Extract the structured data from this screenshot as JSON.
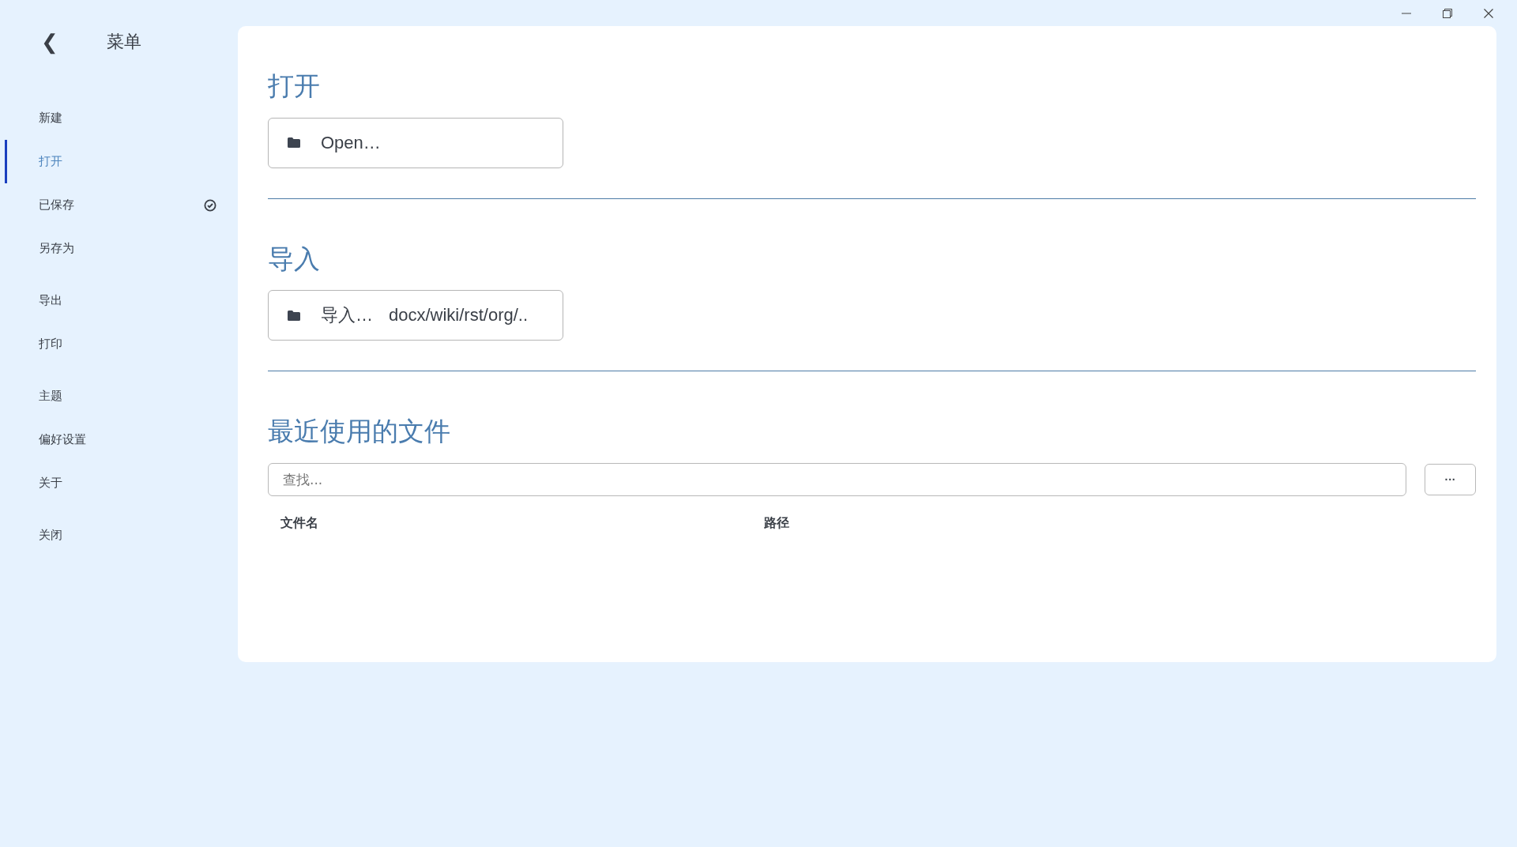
{
  "sidebar": {
    "back": "❮",
    "title": "菜单",
    "groups": [
      [
        {
          "label": "新建",
          "selected": false,
          "kind": "plain"
        },
        {
          "label": "打开",
          "selected": true,
          "kind": "plain"
        },
        {
          "label": "已保存",
          "selected": false,
          "kind": "check"
        },
        {
          "label": "另存为",
          "selected": false,
          "kind": "plain"
        }
      ],
      [
        {
          "label": "导出",
          "selected": false,
          "kind": "plain"
        },
        {
          "label": "打印",
          "selected": false,
          "kind": "plain"
        }
      ],
      [
        {
          "label": "主题",
          "selected": false,
          "kind": "plain"
        },
        {
          "label": "偏好设置",
          "selected": false,
          "kind": "plain"
        },
        {
          "label": "关于",
          "selected": false,
          "kind": "plain"
        }
      ],
      [
        {
          "label": "关闭",
          "selected": false,
          "kind": "plain"
        }
      ]
    ]
  },
  "sections": [
    {
      "heading": "打开",
      "button": {
        "label": "Open…"
      }
    },
    {
      "heading": "导入",
      "button": {
        "label": "导入…",
        "hint": "docx/wiki/rst/org/.."
      }
    }
  ],
  "recent": {
    "heading": "最近使用的文件",
    "search": {
      "placeholder": "查找..."
    },
    "more": "···",
    "columns": [
      "文件名",
      "路径"
    ]
  }
}
